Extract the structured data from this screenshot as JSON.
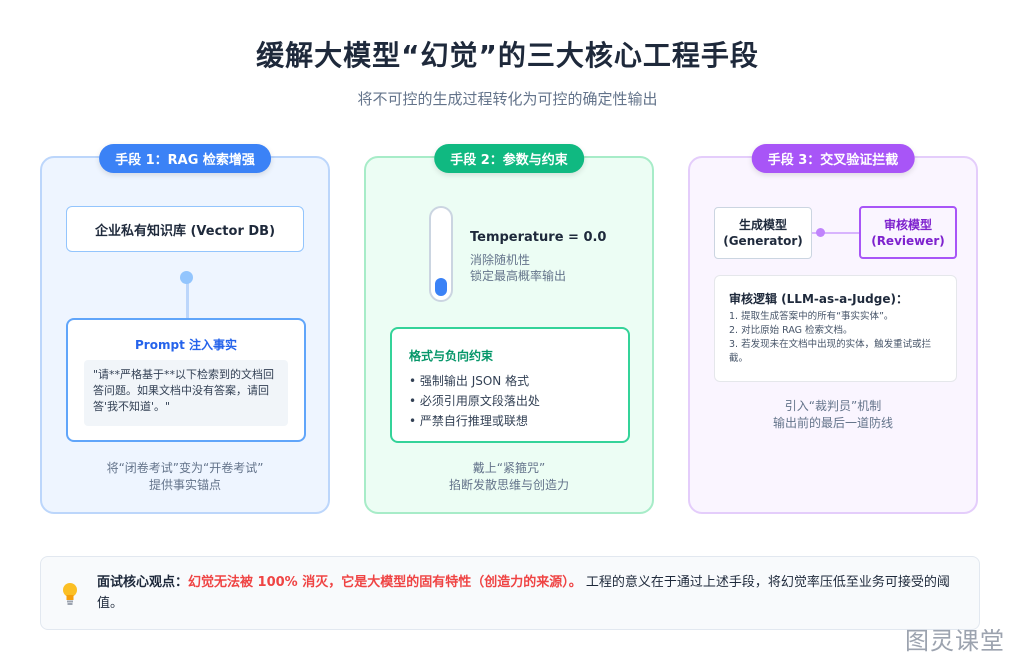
{
  "header": {
    "title": "缓解大模型“幻觉”的三大核心工程手段",
    "subtitle": "将不可控的生成过程转化为可控的确定性输出"
  },
  "panel_rag": {
    "pill": "手段 1：RAG 检索增强",
    "kb_label": "企业私有知识库 (Vector DB)",
    "prompt_title": "Prompt 注入事实",
    "prompt_quote": "\"请**严格基于**以下检索到的文档回答问题。如果文档中没有答案，请回答'我不知道'。\"",
    "caption_line1": "将“闭卷考试”变为“开卷考试”",
    "caption_line2": "提供事实锚点"
  },
  "panel_params": {
    "pill": "手段 2：参数与约束",
    "temperature_label": "Temperature = 0.0",
    "temperature_level": 0,
    "temp_desc_line1": "消除随机性",
    "temp_desc_line2": "锁定最高概率输出",
    "format_title": "格式与负向约束",
    "format_items": [
      "• 强制输出 JSON 格式",
      "• 必须引用原文段落出处",
      "• 严禁自行推理或联想"
    ],
    "caption_line1": "戴上“紧箍咒”",
    "caption_line2": "掐断发散思维与创造力"
  },
  "panel_verify": {
    "pill": "手段 3：交叉验证拦截",
    "generator_line1": "生成模型",
    "generator_line2": "(Generator)",
    "reviewer_line1": "审核模型",
    "reviewer_line2": "(Reviewer)",
    "logic_title": "审核逻辑 (LLM-as-a-Judge)：",
    "logic_items": [
      "1. 提取生成答案中的所有“事实实体”。",
      "2. 对比原始 RAG 检索文档。",
      "3. 若发现未在文档中出现的实体，触发重试或拦截。"
    ],
    "caption_line1": "引入“裁判员”机制",
    "caption_line2": "输出前的最后一道防线"
  },
  "bottom": {
    "lead": "面试核心观点：",
    "highlight": "幻觉无法被 100% 消灭，它是大模型的固有特性（创造力的来源）。",
    "rest": " 工程的意义在于通过上述手段，将幻觉率压低至业务可接受的阈值。"
  },
  "watermark": "图灵课堂",
  "colors": {
    "blue": "#3b82f6",
    "green": "#10b981",
    "purple": "#a855f7",
    "highlight_red": "#ef4444"
  }
}
